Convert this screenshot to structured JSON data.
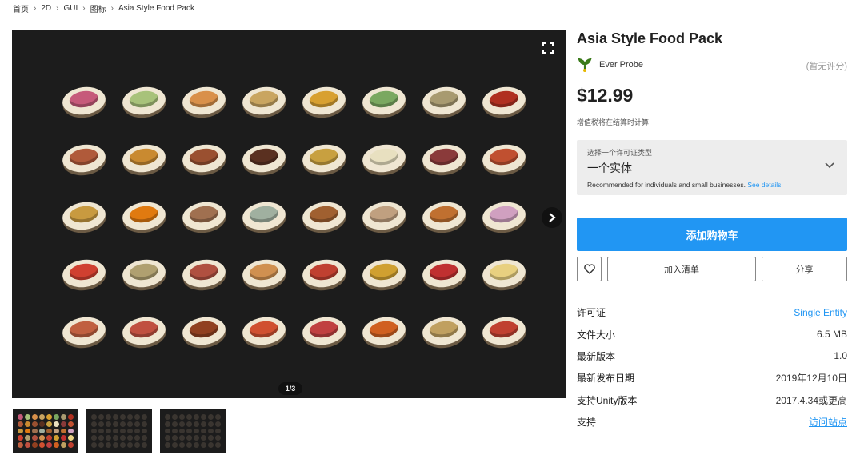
{
  "breadcrumb": [
    "首页",
    "2D",
    "GUI",
    "图标",
    "Asia Style Food Pack"
  ],
  "gallery": {
    "counter": "1/3",
    "dish_colors": [
      [
        "#c65a7a",
        "#a8c27a",
        "#d9904a",
        "#c9a560",
        "#d8a030",
        "#7aa860",
        "#a89a70",
        "#b03020"
      ],
      [
        "#b05a3a",
        "#c98a30",
        "#9a5030",
        "#5a3020",
        "#c8a040",
        "#e8e0c0",
        "#8a3a3a",
        "#c05030"
      ],
      [
        "#c89a40",
        "#e07a10",
        "#a07050",
        "#a0b0a0",
        "#a06030",
        "#c0a080",
        "#c07030",
        "#d0a0c0"
      ],
      [
        "#d04030",
        "#b0a070",
        "#b05040",
        "#d09050",
        "#c04030",
        "#d0a030",
        "#c03030",
        "#e8d080"
      ],
      [
        "#c06040",
        "#c05040",
        "#904020",
        "#d05030",
        "#c04040",
        "#d06020",
        "#c0a060",
        "#c04030"
      ]
    ]
  },
  "thumbnails": [
    {
      "label": "thumbnail-1"
    },
    {
      "label": "thumbnail-2"
    },
    {
      "label": "thumbnail-3"
    }
  ],
  "product": {
    "title": "Asia Style Food Pack",
    "publisher": "Ever Probe",
    "rating": "(暂无评分)",
    "price": "$12.99",
    "tax_note": "增值税将在结算时计算"
  },
  "license": {
    "label": "选择一个许可证类型",
    "value": "一个实体",
    "note": "Recommended for individuals and small businesses.",
    "note_link": "See details."
  },
  "actions": {
    "add_to_cart": "添加购物车",
    "wishlist": "加入清单",
    "share": "分享"
  },
  "info": [
    {
      "key": "许可证",
      "value": "Single Entity",
      "link": true
    },
    {
      "key": "文件大小",
      "value": "6.5 MB",
      "link": false
    },
    {
      "key": "最新版本",
      "value": "1.0",
      "link": false
    },
    {
      "key": "最新发布日期",
      "value": "2019年12月10日",
      "link": false
    },
    {
      "key": "支持Unity版本",
      "value": "2017.4.34或更高",
      "link": false
    },
    {
      "key": "支持",
      "value": "访问站点",
      "link": true
    }
  ],
  "colors": {
    "accent": "#2196f3",
    "gallery_bg": "#1c1c1c",
    "license_bg": "#ededed"
  }
}
